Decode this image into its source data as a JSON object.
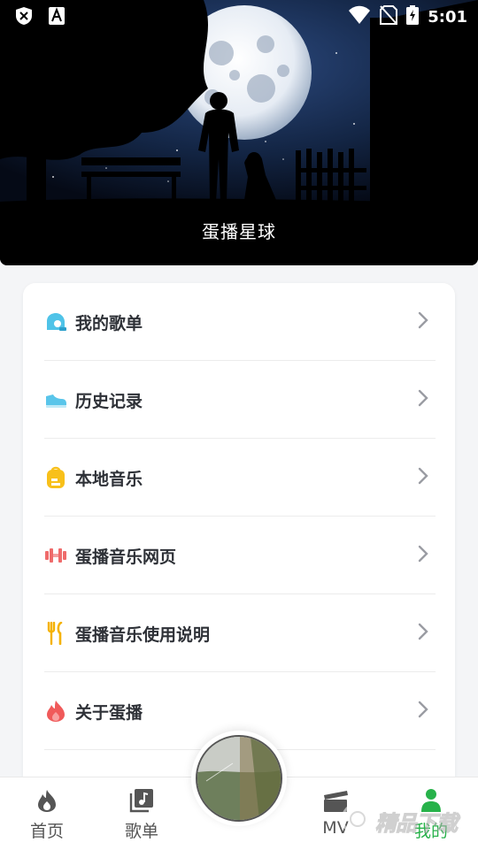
{
  "status_bar": {
    "time": "5:01"
  },
  "hero": {
    "title": "蛋播星球"
  },
  "menu": [
    {
      "id": "my-playlist",
      "label": "我的歌单",
      "icon": "cloud-icon",
      "color": "#4fc3e8"
    },
    {
      "id": "history",
      "label": "历史记录",
      "icon": "shoe-icon",
      "color": "#59c5ea"
    },
    {
      "id": "local-music",
      "label": "本地音乐",
      "icon": "backpack-icon",
      "color": "#f8c01a"
    },
    {
      "id": "web",
      "label": "蛋播音乐网页",
      "icon": "dumbbell-icon",
      "color": "#ef6b6b"
    },
    {
      "id": "manual",
      "label": "蛋播音乐使用说明",
      "icon": "utensils-icon",
      "color": "#f5b200"
    },
    {
      "id": "about",
      "label": "关于蛋播",
      "icon": "flame-icon",
      "color": "#f05a5a"
    }
  ],
  "nav": [
    {
      "id": "home",
      "label": "首页",
      "icon": "flame-icon",
      "active": false
    },
    {
      "id": "playlist",
      "label": "歌单",
      "icon": "music-album-icon",
      "active": false
    },
    {
      "id": "mv",
      "label": "MV",
      "icon": "clapperboard-icon",
      "active": false
    },
    {
      "id": "mine",
      "label": "我的",
      "icon": "person-icon",
      "active": true
    }
  ],
  "colors": {
    "accent": "#27b24a",
    "card_bg": "#ffffff",
    "page_bg": "#f4f5f7"
  },
  "watermark": {
    "text": "精品下载"
  }
}
